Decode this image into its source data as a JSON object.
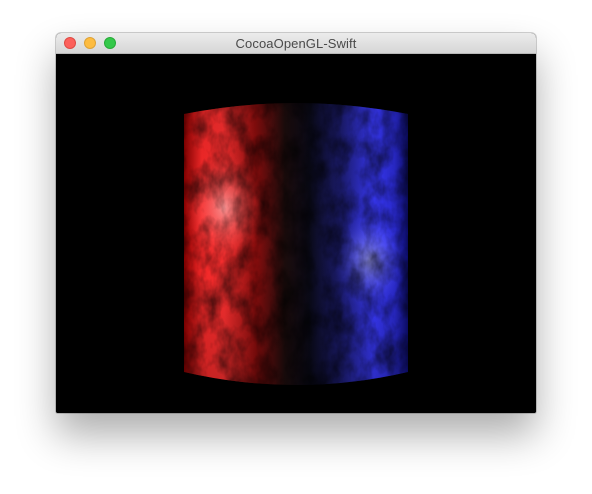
{
  "window": {
    "title": "CocoaOpenGL-Swift",
    "controls": {
      "close": "close-button",
      "minimize": "minimize-button",
      "zoom": "zoom-button"
    }
  },
  "scene": {
    "object": "cylinder",
    "background_color": "#000000",
    "light_left_color": "#ff2020",
    "light_right_color": "#2a2aff"
  }
}
